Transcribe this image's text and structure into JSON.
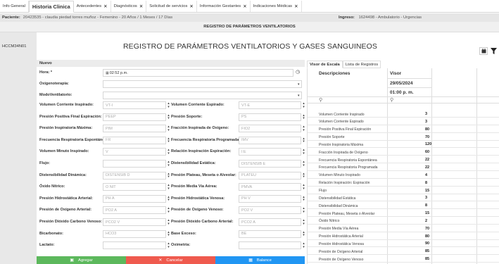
{
  "tabs": [
    {
      "label": "Info General",
      "closable": false,
      "active": false
    },
    {
      "label": "Historia Clinica",
      "closable": false,
      "active": true
    },
    {
      "label": "Antecedentes",
      "closable": true,
      "active": false
    },
    {
      "label": "Diagnósticos",
      "closable": true,
      "active": false
    },
    {
      "label": "Solicitud de servicios",
      "closable": true,
      "active": false
    },
    {
      "label": "Información Gestantes",
      "closable": true,
      "active": false
    },
    {
      "label": "Indicaciones Médicas",
      "closable": true,
      "active": false
    }
  ],
  "patient": {
    "label": "Paciente:",
    "value": "20423535 - claudia piedad torres muñoz - Femenino - 20 Años / 1 Meses / 17 Días",
    "ingreso_label": "Ingreso:",
    "ingreso_value": "1624498 - Ambulatorio - Urgencias"
  },
  "section_header": "REGISTRO DE PARÁMETROS VENTILATORIOS",
  "left_code": "HCCM34N01",
  "main_title": "REGISTRO DE PARÁMETROS VENTILATORIOS Y GASES SANGUINEOS",
  "form": {
    "head": "Nuevo",
    "hora_label": "Hora: *",
    "hora_value": "02:52 p.m.",
    "oxigenoterapia_label": "Oxigenoterapia:",
    "modo_label": "ModoVentilatorio:",
    "left_fields": [
      {
        "label": "Volumen Corriente Inspirado:",
        "placeholder": "VT-I"
      },
      {
        "label": "Presión Positiva Final Espiración:",
        "placeholder": "PEEP"
      },
      {
        "label": "Presión Inspiratoria Máxima:",
        "placeholder": "PIM"
      },
      {
        "label": "Frecuencia Respiratoria Espontánea:",
        "placeholder": "FR"
      },
      {
        "label": "Volumen Minuto Inspirado:",
        "placeholder": "V"
      },
      {
        "label": "Flujo:",
        "placeholder": ""
      },
      {
        "label": "Distensibilidad Dinámica:",
        "placeholder": "DISTENSIB D"
      },
      {
        "label": "Óxido Nítrico:",
        "placeholder": "O NIT"
      },
      {
        "label": "Presión Hidrostática Arterial:",
        "placeholder": "PH A"
      },
      {
        "label": "Presión de Oxígeno Arterial:",
        "placeholder": "PO2 A"
      },
      {
        "label": "Presión Dióxido Carbono Venoso:",
        "placeholder": "PCO2 V"
      },
      {
        "label": "Bicarbonato:",
        "placeholder": "HCO3"
      },
      {
        "label": "Lactato:",
        "placeholder": ""
      }
    ],
    "right_fields": [
      {
        "label": "Volumen Corriente Espirado:",
        "placeholder": "VT-E"
      },
      {
        "label": "Presión Soporte:",
        "placeholder": "PS"
      },
      {
        "label": "Fracción Inspirada de Oxígeno:",
        "placeholder": "FIO2"
      },
      {
        "label": "Frecuencia Respiratoria Programada:",
        "placeholder": "IMV"
      },
      {
        "label": "Relación Inspiración Espiración:",
        "placeholder": "I:E"
      },
      {
        "label": "Distensibilidad Estática:",
        "placeholder": "DISTENSIB E"
      },
      {
        "label": "Presión Plateau, Meseta o Alveolar:",
        "placeholder": "PLATEU"
      },
      {
        "label": "Presión Media Vía Aérea:",
        "placeholder": "PMVA"
      },
      {
        "label": "Presión Hidrostática Venosa:",
        "placeholder": "PH V"
      },
      {
        "label": "Presión de Oxígeno Venoso:",
        "placeholder": "PO2 V"
      },
      {
        "label": "Presión Dióxido Carbono Arterial:",
        "placeholder": "PCO2 A"
      },
      {
        "label": "Base Exceso:",
        "placeholder": "BE"
      },
      {
        "label": "Oximetría:",
        "placeholder": ""
      }
    ]
  },
  "buttons": {
    "agregar": "Agregar",
    "cancelar": "Cancelar",
    "balance": "Balance"
  },
  "right_panel": {
    "tabs": [
      "Visor de Escala",
      "Lista de Registros"
    ],
    "col_desc": "Descripciones",
    "col_visor": "Visor",
    "date": "29/05/2024",
    "time": "01:00 p. m.",
    "rows": [
      {
        "desc": "Volumen Corriente Inspirado",
        "value": "3"
      },
      {
        "desc": "Volumen Corriente Espirado",
        "value": "3"
      },
      {
        "desc": "Presión Positiva Final Espiración",
        "value": "80"
      },
      {
        "desc": "Presión Soporte",
        "value": "70"
      },
      {
        "desc": "Presión Inspiratoria Máxima",
        "value": "120"
      },
      {
        "desc": "Fracción Inspirada de Oxígeno",
        "value": "60"
      },
      {
        "desc": "Frecuencia Respiratoria Espontánea",
        "value": "22"
      },
      {
        "desc": "Frecuencia Respiratoria Programada",
        "value": "22"
      },
      {
        "desc": "Volumen Minuto Inspirado",
        "value": "4"
      },
      {
        "desc": "Relación Inspiración: Espiración",
        "value": "8"
      },
      {
        "desc": "Flujo",
        "value": "15"
      },
      {
        "desc": "Distensibilidad Estática",
        "value": "3"
      },
      {
        "desc": "Distensibilidad Dinámica",
        "value": "8"
      },
      {
        "desc": "Presión Plateau, Meseta o Alveolar",
        "value": "15"
      },
      {
        "desc": "Óxido Nítrico",
        "value": "2"
      },
      {
        "desc": "Presión Media Vía Aérea",
        "value": "70"
      },
      {
        "desc": "Presión Hidrostática Arterial",
        "value": "80"
      },
      {
        "desc": "Presión Hidrostática Venosa",
        "value": "90"
      },
      {
        "desc": "Presión de Oxígeno Arterial",
        "value": "85"
      },
      {
        "desc": "Presión de Oxígeno Venoso",
        "value": "85"
      }
    ]
  }
}
